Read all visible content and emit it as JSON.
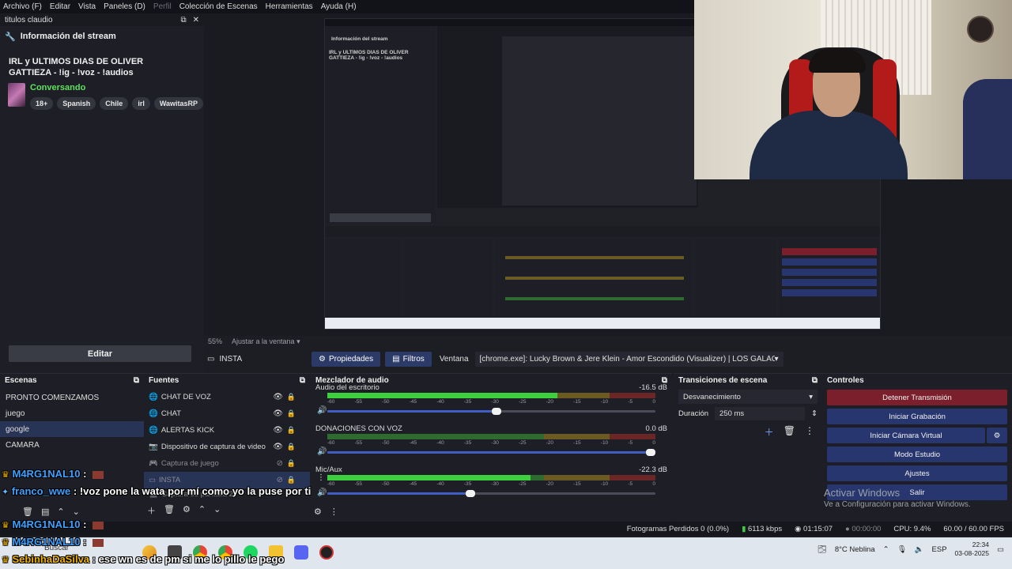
{
  "menubar": {
    "items": [
      "Archivo (F)",
      "Editar",
      "Vista",
      "Paneles (D)",
      "Perfil",
      "Colección de Escenas",
      "Herramientas",
      "Ayuda (H)"
    ]
  },
  "info_dock": {
    "title": "titulos claudio",
    "section": "Información del stream",
    "stream_title": "IRL y ULTIMOS DIAS DE OLIVER GATTIEZA - !ig - !voz - !audios",
    "category": "Conversando",
    "tags": [
      "18+",
      "Spanish",
      "Chile",
      "irl",
      "WawitasRP"
    ],
    "edit_label": "Editar"
  },
  "preview": {
    "zoom": "55%",
    "fit_label": "Ajustar a la ventana",
    "nested_title": "Información del stream",
    "nested_stream_title": "IRL y ULTIMOS DIAS DE OLIVER GATTIEZA - !ig - !voz - !audios"
  },
  "context": {
    "scene": "INSTA",
    "properties_label": "Propiedades",
    "filters_label": "Filtros",
    "window_label": "Ventana",
    "window_value": "[chrome.exe]: Lucky Brown & Jere Klein - Amor Escondido (Visualizer) | LOS GALÁCTICOS - You"
  },
  "scenes": {
    "title": "Escenas",
    "items": [
      "PRONTO COMENZAMOS",
      "juego",
      "google",
      "CAMARA"
    ],
    "selected": 2
  },
  "sources": {
    "title": "Fuentes",
    "items": [
      {
        "label": "CHAT DE VOZ",
        "icon": "globe-icon"
      },
      {
        "label": "CHAT",
        "icon": "globe-icon"
      },
      {
        "label": "ALERTAS KICK",
        "icon": "globe-icon"
      },
      {
        "label": "Dispositivo de captura de video",
        "icon": "camera-icon"
      },
      {
        "label": "Captura de juego",
        "icon": "gamepad-icon"
      },
      {
        "label": "INSTA",
        "icon": "window-icon"
      },
      {
        "label": "Captura de pantalla 2",
        "icon": "monitor-icon"
      }
    ]
  },
  "mixer": {
    "title": "Mezclador de audio",
    "scale": [
      "-60",
      "-55",
      "-50",
      "-45",
      "-40",
      "-35",
      "-30",
      "-25",
      "-20",
      "-15",
      "-10",
      "-5",
      "0"
    ],
    "channels": [
      {
        "name": "Audio del escritorio",
        "db": "-16.5 dB",
        "level": 0.7,
        "volume": 0.53
      },
      {
        "name": "DONACIONES CON VOZ",
        "db": "0.0 dB",
        "level": 0.0,
        "volume": 1.0
      },
      {
        "name": "Mic/Aux",
        "db": "-22.3 dB",
        "level": 0.62,
        "volume": 0.45
      }
    ]
  },
  "transitions": {
    "title": "Transiciones de escena",
    "type": "Desvanecimiento",
    "duration_label": "Duración",
    "duration": "250 ms"
  },
  "controls": {
    "title": "Controles",
    "buttons": [
      "Detener Transmisión",
      "Iniciar Grabación",
      "Iniciar Cámara Virtual",
      "Modo Estudio",
      "Ajustes",
      "Salir"
    ]
  },
  "activation": {
    "line1": "Activar Windows",
    "line2": "Ve a Configuración para activar Windows."
  },
  "status": {
    "dropped": "Fotogramas Perdidos 0 (0.0%)",
    "bitrate": "6113 kbps",
    "stream_time": "01:15:07",
    "rec_time": "00:00:00",
    "cpu": "CPU: 9.4%",
    "fps": "60.00 / 60.00 FPS"
  },
  "taskbar": {
    "search": "Buscar",
    "weather": "8°C  Neblina",
    "lang": "ESP",
    "time": "22:34",
    "date": "03-08-2025"
  },
  "chat": [
    {
      "user": "M4RG1NAL10",
      "msg": ":"
    },
    {
      "user": "franco_wwe",
      "msg": ": !voz pone la wata por mí como yo la puse por ti"
    },
    {
      "user": "M4RG1NAL10",
      "msg": ":"
    },
    {
      "user": "M4RG1NAL10",
      "msg": ":"
    },
    {
      "user": "SebinhaDaSilva",
      "msg": ": ese wn es de pm si me lo pillo le pego"
    }
  ],
  "colors": {
    "accent": "#2c3a67",
    "stop_stream": "#7a1f2b",
    "category": "#5ee05e",
    "chat_user": "#3ea1ff"
  }
}
